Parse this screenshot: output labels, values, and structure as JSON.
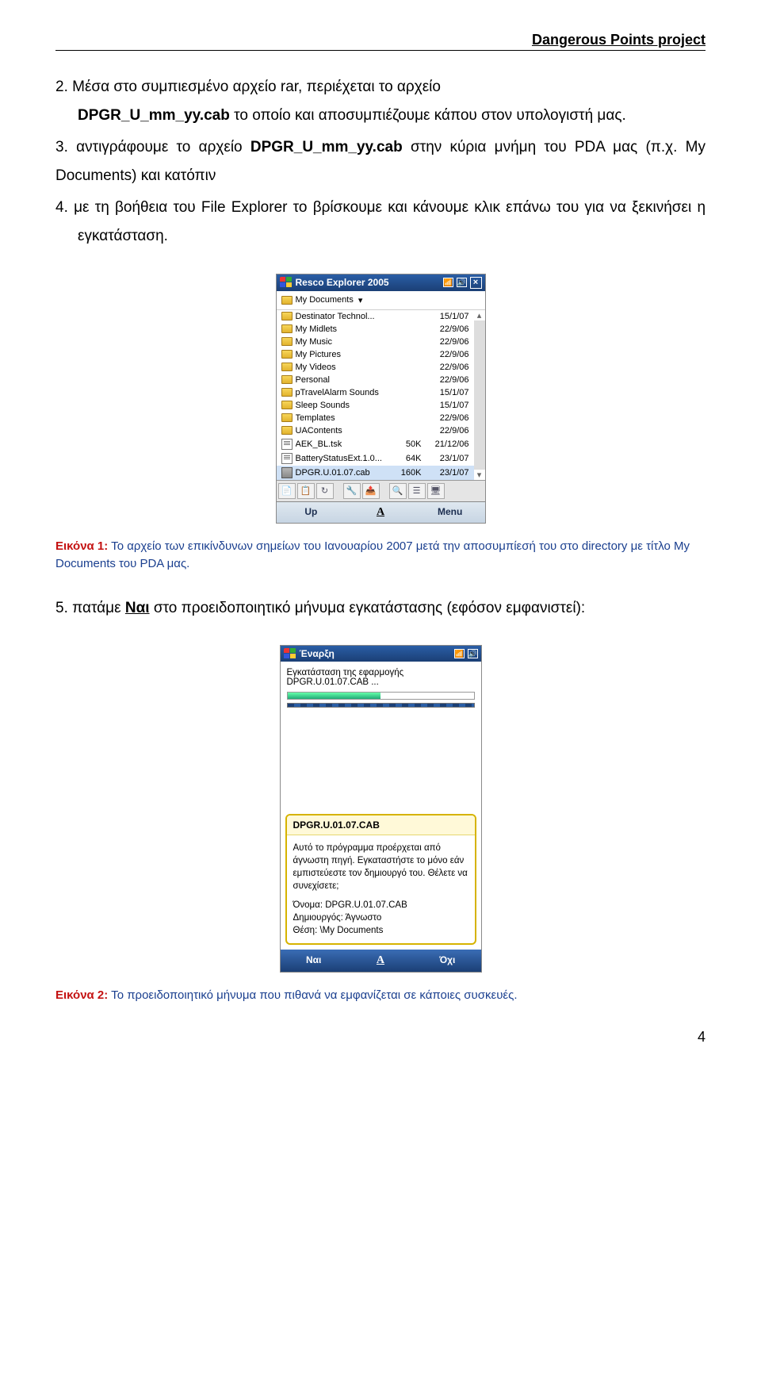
{
  "header": {
    "project": "Dangerous Points project"
  },
  "body": {
    "item2_prefix": "2. ",
    "item2_a": "Μέσα στο συμπιεσμένο αρχείο rar, περιέχεται το αρχείο ",
    "item2_code1": "DPGR_U_mm_yy.cab",
    "item2_b": " το οποίο και αποσυμπιέζουμε κάπου στον υπολογιστή μας.",
    "item3_prefix": "3. ",
    "item3_a": "αντιγράφουμε το αρχείο ",
    "item3_code": "DPGR_U_mm_yy.cab",
    "item3_b": " στην κύρια μνήμη του PDA μας (π.χ. My Documents) και κατόπιν",
    "item4_prefix": "4. ",
    "item4": "με τη βοήθεια του File Explorer το βρίσκουμε και κάνουμε κλικ επάνω του για να ξεκινήσει η εγκατάσταση.",
    "item5_prefix": "5. ",
    "item5_a": "πατάμε ",
    "item5_bold": "Ναι",
    "item5_b": " στο προειδοποιητικό μήνυμα εγκατάστασης (εφόσον εμφανιστεί):"
  },
  "fig1": {
    "lead": "Εικόνα 1:",
    "text": "  Το αρχείο των επικίνδυνων σημείων του Ιανουαρίου 2007 μετά την αποσυμπίεσή του στο directory με τίτλο My Documents του PDA μας.",
    "title": "Resco Explorer 2005",
    "path": "My Documents",
    "rows": [
      {
        "icon": "folder",
        "name": "Destinator Technol...",
        "size": "",
        "date": "15/1/07"
      },
      {
        "icon": "folder",
        "name": "My Midlets",
        "size": "",
        "date": "22/9/06"
      },
      {
        "icon": "folder",
        "name": "My Music",
        "size": "",
        "date": "22/9/06"
      },
      {
        "icon": "folder",
        "name": "My Pictures",
        "size": "",
        "date": "22/9/06"
      },
      {
        "icon": "folder",
        "name": "My Videos",
        "size": "",
        "date": "22/9/06"
      },
      {
        "icon": "folder",
        "name": "Personal",
        "size": "",
        "date": "22/9/06"
      },
      {
        "icon": "folder",
        "name": "pTravelAlarm Sounds",
        "size": "",
        "date": "15/1/07"
      },
      {
        "icon": "folder",
        "name": "Sleep Sounds",
        "size": "",
        "date": "15/1/07"
      },
      {
        "icon": "folder",
        "name": "Templates",
        "size": "",
        "date": "22/9/06"
      },
      {
        "icon": "folder",
        "name": "UAContents",
        "size": "",
        "date": "22/9/06"
      },
      {
        "icon": "doc",
        "name": "AEK_BL.tsk",
        "size": "50K",
        "date": "21/12/06"
      },
      {
        "icon": "doc",
        "name": "BatteryStatusExt.1.0...",
        "size": "64K",
        "date": "23/1/07"
      },
      {
        "icon": "cab",
        "name": "DPGR.U.01.07.cab",
        "size": "160K",
        "date": "23/1/07"
      }
    ],
    "mb_left": "Up",
    "mb_right": "Menu"
  },
  "fig2": {
    "lead": "Εικόνα 2:",
    "text": "  Το προειδοποιητικό μήνυμα που πιθανά να εμφανίζεται σε κάποιες συσκευές.",
    "title": "Έναρξη",
    "install_line": "Εγκατάσταση της εφαρμογής DPGR.U.01.07.CAB ...",
    "warn_hdr": "DPGR.U.01.07.CAB",
    "warn_body": "Αυτό το πρόγραμμα προέρχεται από άγνωστη πηγή. Εγκαταστήστε το μόνο εάν εμπιστεύεστε τον δημιουργό του. Θέλετε να συνεχίσετε;",
    "warn_name_lbl": "Όνομα: ",
    "warn_name": "DPGR.U.01.07.CAB",
    "warn_pub_lbl": "Δημιουργός: ",
    "warn_pub": "Άγνωστο",
    "warn_loc_lbl": "Θέση: ",
    "warn_loc": "\\My Documents",
    "mb_left": "Ναι",
    "mb_right": "Όχι"
  },
  "pagenum": "4"
}
